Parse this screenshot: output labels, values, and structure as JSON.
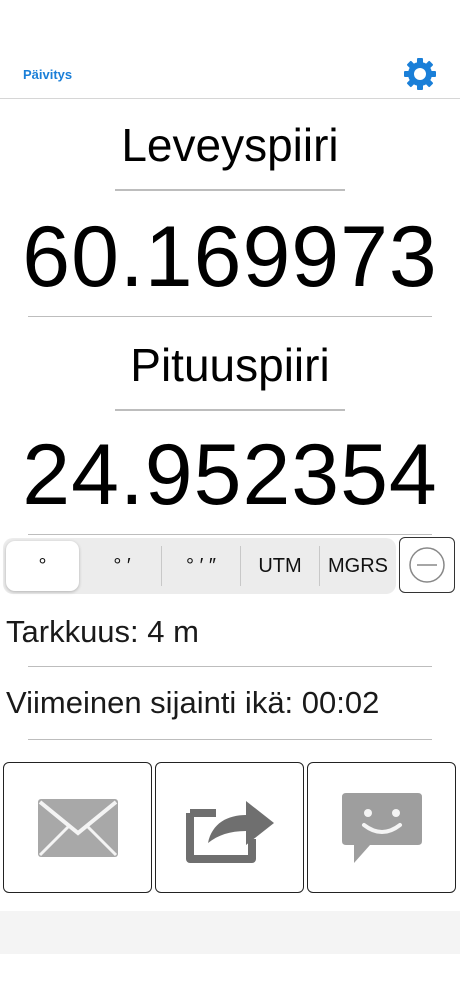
{
  "nav": {
    "refresh_label": "Päivitys",
    "settings_icon": "gear-icon",
    "accent": "#1a7fd8"
  },
  "latitude": {
    "label": "Leveyspiiri",
    "value": "60.169973"
  },
  "longitude": {
    "label": "Pituuspiiri",
    "value": "24.952354"
  },
  "format_selector": {
    "options": [
      "°",
      "° ′",
      "° ′ ″",
      "UTM",
      "MGRS"
    ],
    "selected": "°"
  },
  "accuracy": {
    "text": "Tarkkuus: 4 m"
  },
  "last_location_age": {
    "text": "Viimeinen sijainti ikä: 00:02"
  },
  "actions": [
    {
      "icon": "envelope-icon"
    },
    {
      "icon": "share-icon"
    },
    {
      "icon": "message-bubble-icon"
    }
  ]
}
